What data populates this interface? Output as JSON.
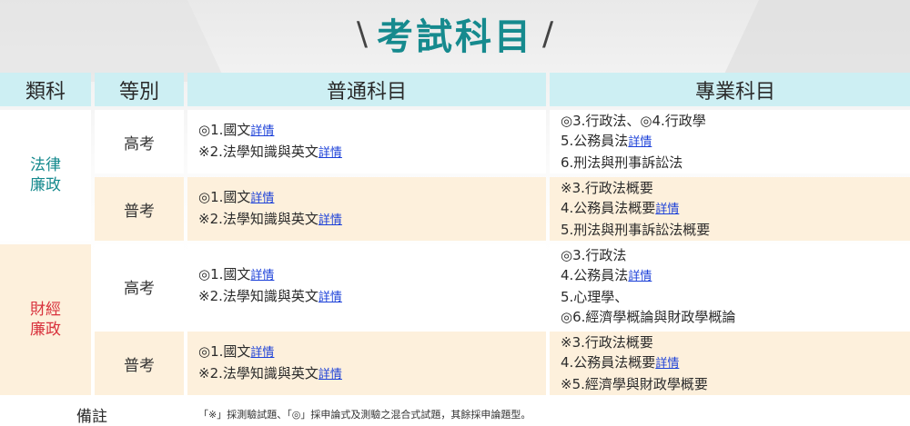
{
  "header": {
    "slash_left": "\\",
    "title": "考試科目",
    "slash_right": "/"
  },
  "table": {
    "headers": [
      "類科",
      "等別",
      "普通科目",
      "專業科目"
    ],
    "groups": [
      {
        "category": [
          "法律",
          "廉政"
        ],
        "rows": [
          {
            "grade": "高考",
            "general": [
              {
                "text": "◎1.國文",
                "link": "詳情"
              },
              {
                "text": "※2.法學知識與英文",
                "link": "詳情"
              }
            ],
            "professional": [
              {
                "text": "◎3.行政法、◎4.行政學",
                "link": ""
              },
              {
                "text": "5.公務員法",
                "link": "詳情"
              },
              {
                "text": "6.刑法與刑事訴訟法",
                "link": ""
              }
            ]
          },
          {
            "grade": "普考",
            "general": [
              {
                "text": "◎1.國文",
                "link": "詳情"
              },
              {
                "text": "※2.法學知識與英文",
                "link": "詳情"
              }
            ],
            "professional": [
              {
                "text": "※3.行政法概要",
                "link": ""
              },
              {
                "text": "4.公務員法概要",
                "link": "詳情"
              },
              {
                "text": "5.刑法與刑事訴訟法概要",
                "link": ""
              }
            ]
          }
        ]
      },
      {
        "category": [
          "財經",
          "廉政"
        ],
        "rows": [
          {
            "grade": "高考",
            "general": [
              {
                "text": "◎1.國文",
                "link": "詳情"
              },
              {
                "text": "※2.法學知識與英文",
                "link": "詳情"
              }
            ],
            "professional": [
              {
                "text": "◎3.行政法",
                "link": ""
              },
              {
                "text": "4.公務員法",
                "link": "詳情"
              },
              {
                "text": "5.心理學、",
                "link": ""
              },
              {
                "text": "◎6.經濟學概論與財政學概論",
                "link": ""
              }
            ]
          },
          {
            "grade": "普考",
            "general": [
              {
                "text": "◎1.國文",
                "link": "詳情"
              },
              {
                "text": "※2.法學知識與英文",
                "link": "詳情"
              }
            ],
            "professional": [
              {
                "text": "※3.行政法概要",
                "link": ""
              },
              {
                "text": "4.公務員法概要",
                "link": "詳情"
              },
              {
                "text": "※5.經濟學與財政學概要",
                "link": ""
              }
            ]
          }
        ]
      }
    ],
    "note_label": "備註",
    "note_text": "「※」採測驗試題、「◎」採申論式及測驗之混合式試題，其餘採申論題型。"
  },
  "colors": {
    "title": "#168a8e",
    "header_bg": "#cdeff3",
    "cream_bg": "#fdf0dc",
    "cat_teal": "#168a8e",
    "cat_red": "#d8313c",
    "link": "#1a3fd8"
  }
}
